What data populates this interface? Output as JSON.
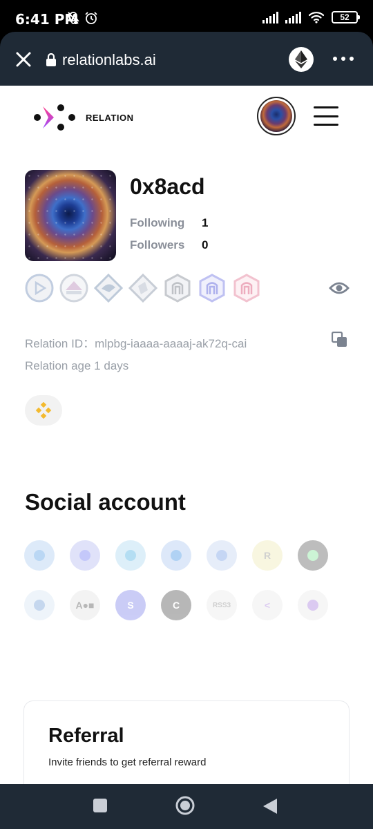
{
  "status_bar": {
    "time": "6:41 PM",
    "battery": "52"
  },
  "browser": {
    "url": "relationlabs.ai"
  },
  "header": {
    "logo_text": "RELATION"
  },
  "profile": {
    "name": "0x8acd",
    "following_label": "Following",
    "following_count": "1",
    "followers_label": "Followers",
    "followers_count": "0",
    "relation_id": "Relation ID：mlpbg-iaaaa-aaaaj-ak72q-cai",
    "relation_age": "Relation age 1 days"
  },
  "badges": [
    {
      "icon": "play-badge-icon",
      "color": "#8fa6c8"
    },
    {
      "icon": "dome-badge-icon",
      "color": "#c6a2c8"
    },
    {
      "icon": "cap-badge-icon",
      "color": "#8aa0bb"
    },
    {
      "icon": "diamond-badge-icon",
      "color": "#9aa5b5"
    },
    {
      "icon": "arch-badge-icon",
      "color": "#9aa0a8"
    },
    {
      "icon": "arch-violet-badge-icon",
      "color": "#8b8fe8"
    },
    {
      "icon": "arch-pink-badge-icon",
      "color": "#e892a8"
    }
  ],
  "social": {
    "title": "Social account",
    "accounts": [
      {
        "icon": "twitter-icon",
        "bg": "#9fc4ee",
        "fg": "#3b8ee0",
        "glyph": ""
      },
      {
        "icon": "discord-icon",
        "bg": "#a9aef0",
        "fg": "#5865f2",
        "glyph": ""
      },
      {
        "icon": "telegram-icon",
        "bg": "#9fd2ee",
        "fg": "#2aa3de",
        "glyph": ""
      },
      {
        "icon": "opensea-icon",
        "bg": "#9fc0ee",
        "fg": "#2081e2",
        "glyph": ""
      },
      {
        "icon": "mirror-icon",
        "bg": "#b9cdf0",
        "fg": "#5b8be0",
        "glyph": ""
      },
      {
        "icon": "rabbithole-icon",
        "bg": "#ece7a8",
        "fg": "#7a7a7a",
        "glyph": "R"
      },
      {
        "icon": "eye-app-icon",
        "bg": "#444444",
        "fg": "#6fe08a",
        "glyph": ""
      },
      {
        "icon": "circle-app-icon",
        "bg": "#cfe0f2",
        "fg": "#5b8fd0",
        "glyph": ""
      },
      {
        "icon": "aoe-icon",
        "bg": "#dddddd",
        "fg": "#333333",
        "glyph": "A●■"
      },
      {
        "icon": "s-app-icon",
        "bg": "#6b6fe8",
        "fg": "#ffffff",
        "glyph": "S"
      },
      {
        "icon": "c-app-icon",
        "bg": "#333333",
        "fg": "#ffffff",
        "glyph": "C"
      },
      {
        "icon": "rss3-icon",
        "bg": "#e6e6e6",
        "fg": "#777777",
        "glyph": "RSS3"
      },
      {
        "icon": "galxe-icon",
        "bg": "#e6e6e6",
        "fg": "#9a6ad8",
        "glyph": "<"
      },
      {
        "icon": "layer-app-icon",
        "bg": "#e6e6e6",
        "fg": "#9a6ad8",
        "glyph": ""
      }
    ]
  },
  "referral": {
    "title": "Referral",
    "subtitle": "Invite friends to get referral reward"
  }
}
